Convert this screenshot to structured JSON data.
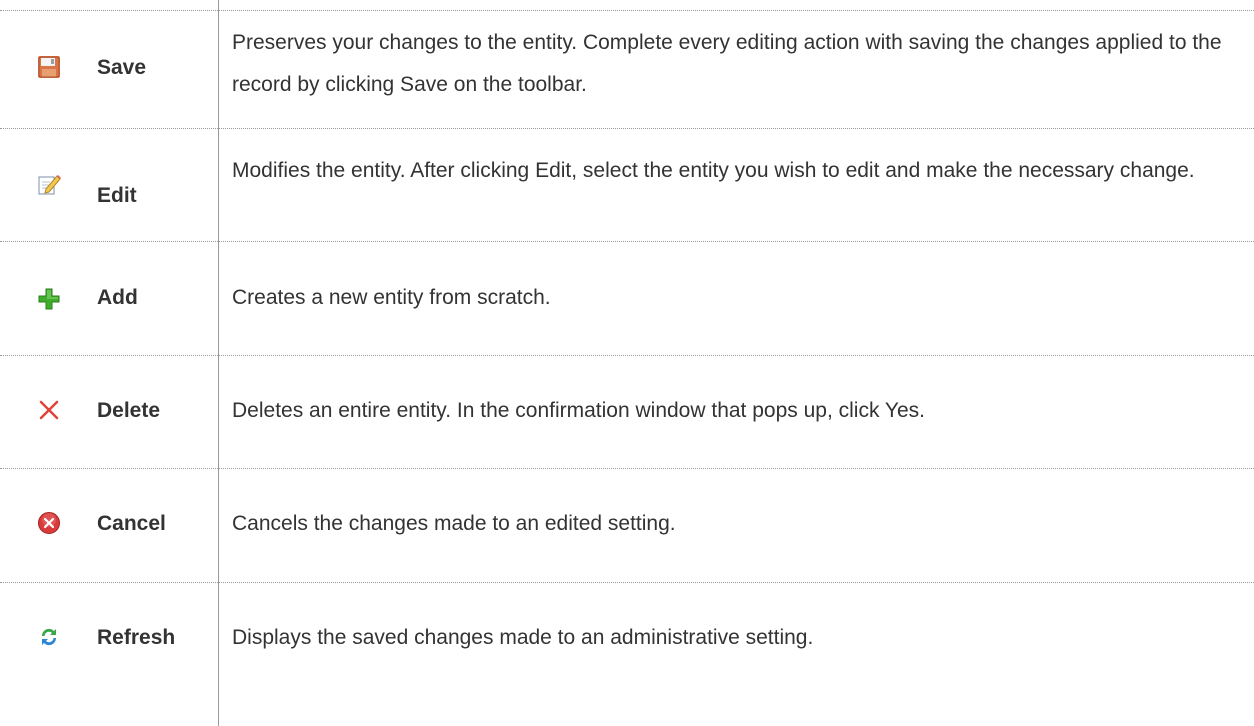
{
  "rows": [
    {
      "icon": "save-icon",
      "name": "Save",
      "description": "Preserves your changes to the entity. Complete every editing action with saving the changes applied to the record by clicking Save on the toolbar."
    },
    {
      "icon": "edit-icon",
      "name": "Edit",
      "description": "Modifies the entity. After clicking Edit, select the entity you wish to edit and make the necessary change."
    },
    {
      "icon": "add-icon",
      "name": "Add",
      "description": "Creates a new entity from scratch."
    },
    {
      "icon": "delete-icon",
      "name": "Delete",
      "description": "Deletes an entire entity. In the confirmation window that pops up, click Yes."
    },
    {
      "icon": "cancel-icon",
      "name": "Cancel",
      "description": "Cancels the changes made to an edited setting."
    },
    {
      "icon": "refresh-icon",
      "name": "Refresh",
      "description": "Displays the saved changes made to an administrative setting."
    }
  ],
  "colors": {
    "text": "#333333",
    "rule": "#9a9a9a",
    "add_green": "#3fae2a",
    "delete_red": "#e0423a",
    "cancel_red": "#d93a3a",
    "refresh_green": "#3aa84a",
    "refresh_blue": "#2f86d6"
  }
}
